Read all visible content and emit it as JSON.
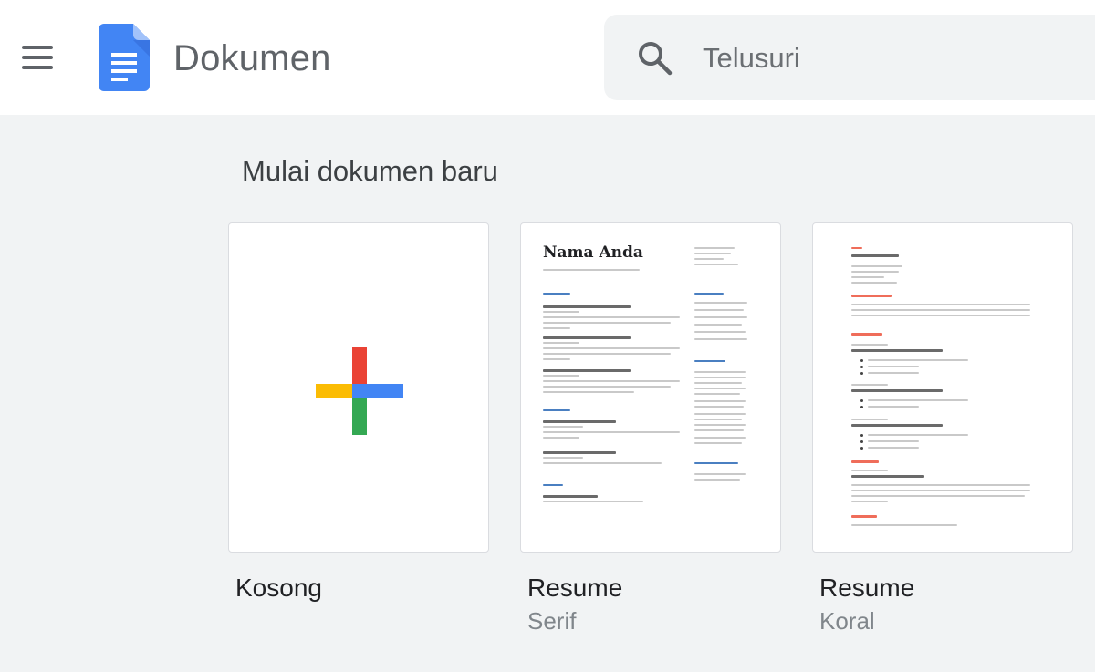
{
  "header": {
    "app_title": "Dokumen",
    "menu_icon": "hamburger-menu-icon",
    "logo_icon": "google-docs-icon"
  },
  "search": {
    "placeholder": "Telusuri",
    "icon": "search-icon"
  },
  "section_title": "Mulai dokumen baru",
  "templates": [
    {
      "title": "Kosong",
      "subtitle": "",
      "thumbnail": "blank-plus"
    },
    {
      "title": "Resume",
      "subtitle": "Serif",
      "thumbnail": "resume-serif",
      "preview_name": "Nama Anda"
    },
    {
      "title": "Resume",
      "subtitle": "Koral",
      "thumbnail": "resume-coral"
    }
  ],
  "colors": {
    "docs_blue": "#4285f4",
    "google_red": "#ea4335",
    "google_yellow": "#fbbc04",
    "google_green": "#34a853",
    "coral_accent": "#ef6d5a",
    "serif_accent": "#4a7fc1"
  }
}
